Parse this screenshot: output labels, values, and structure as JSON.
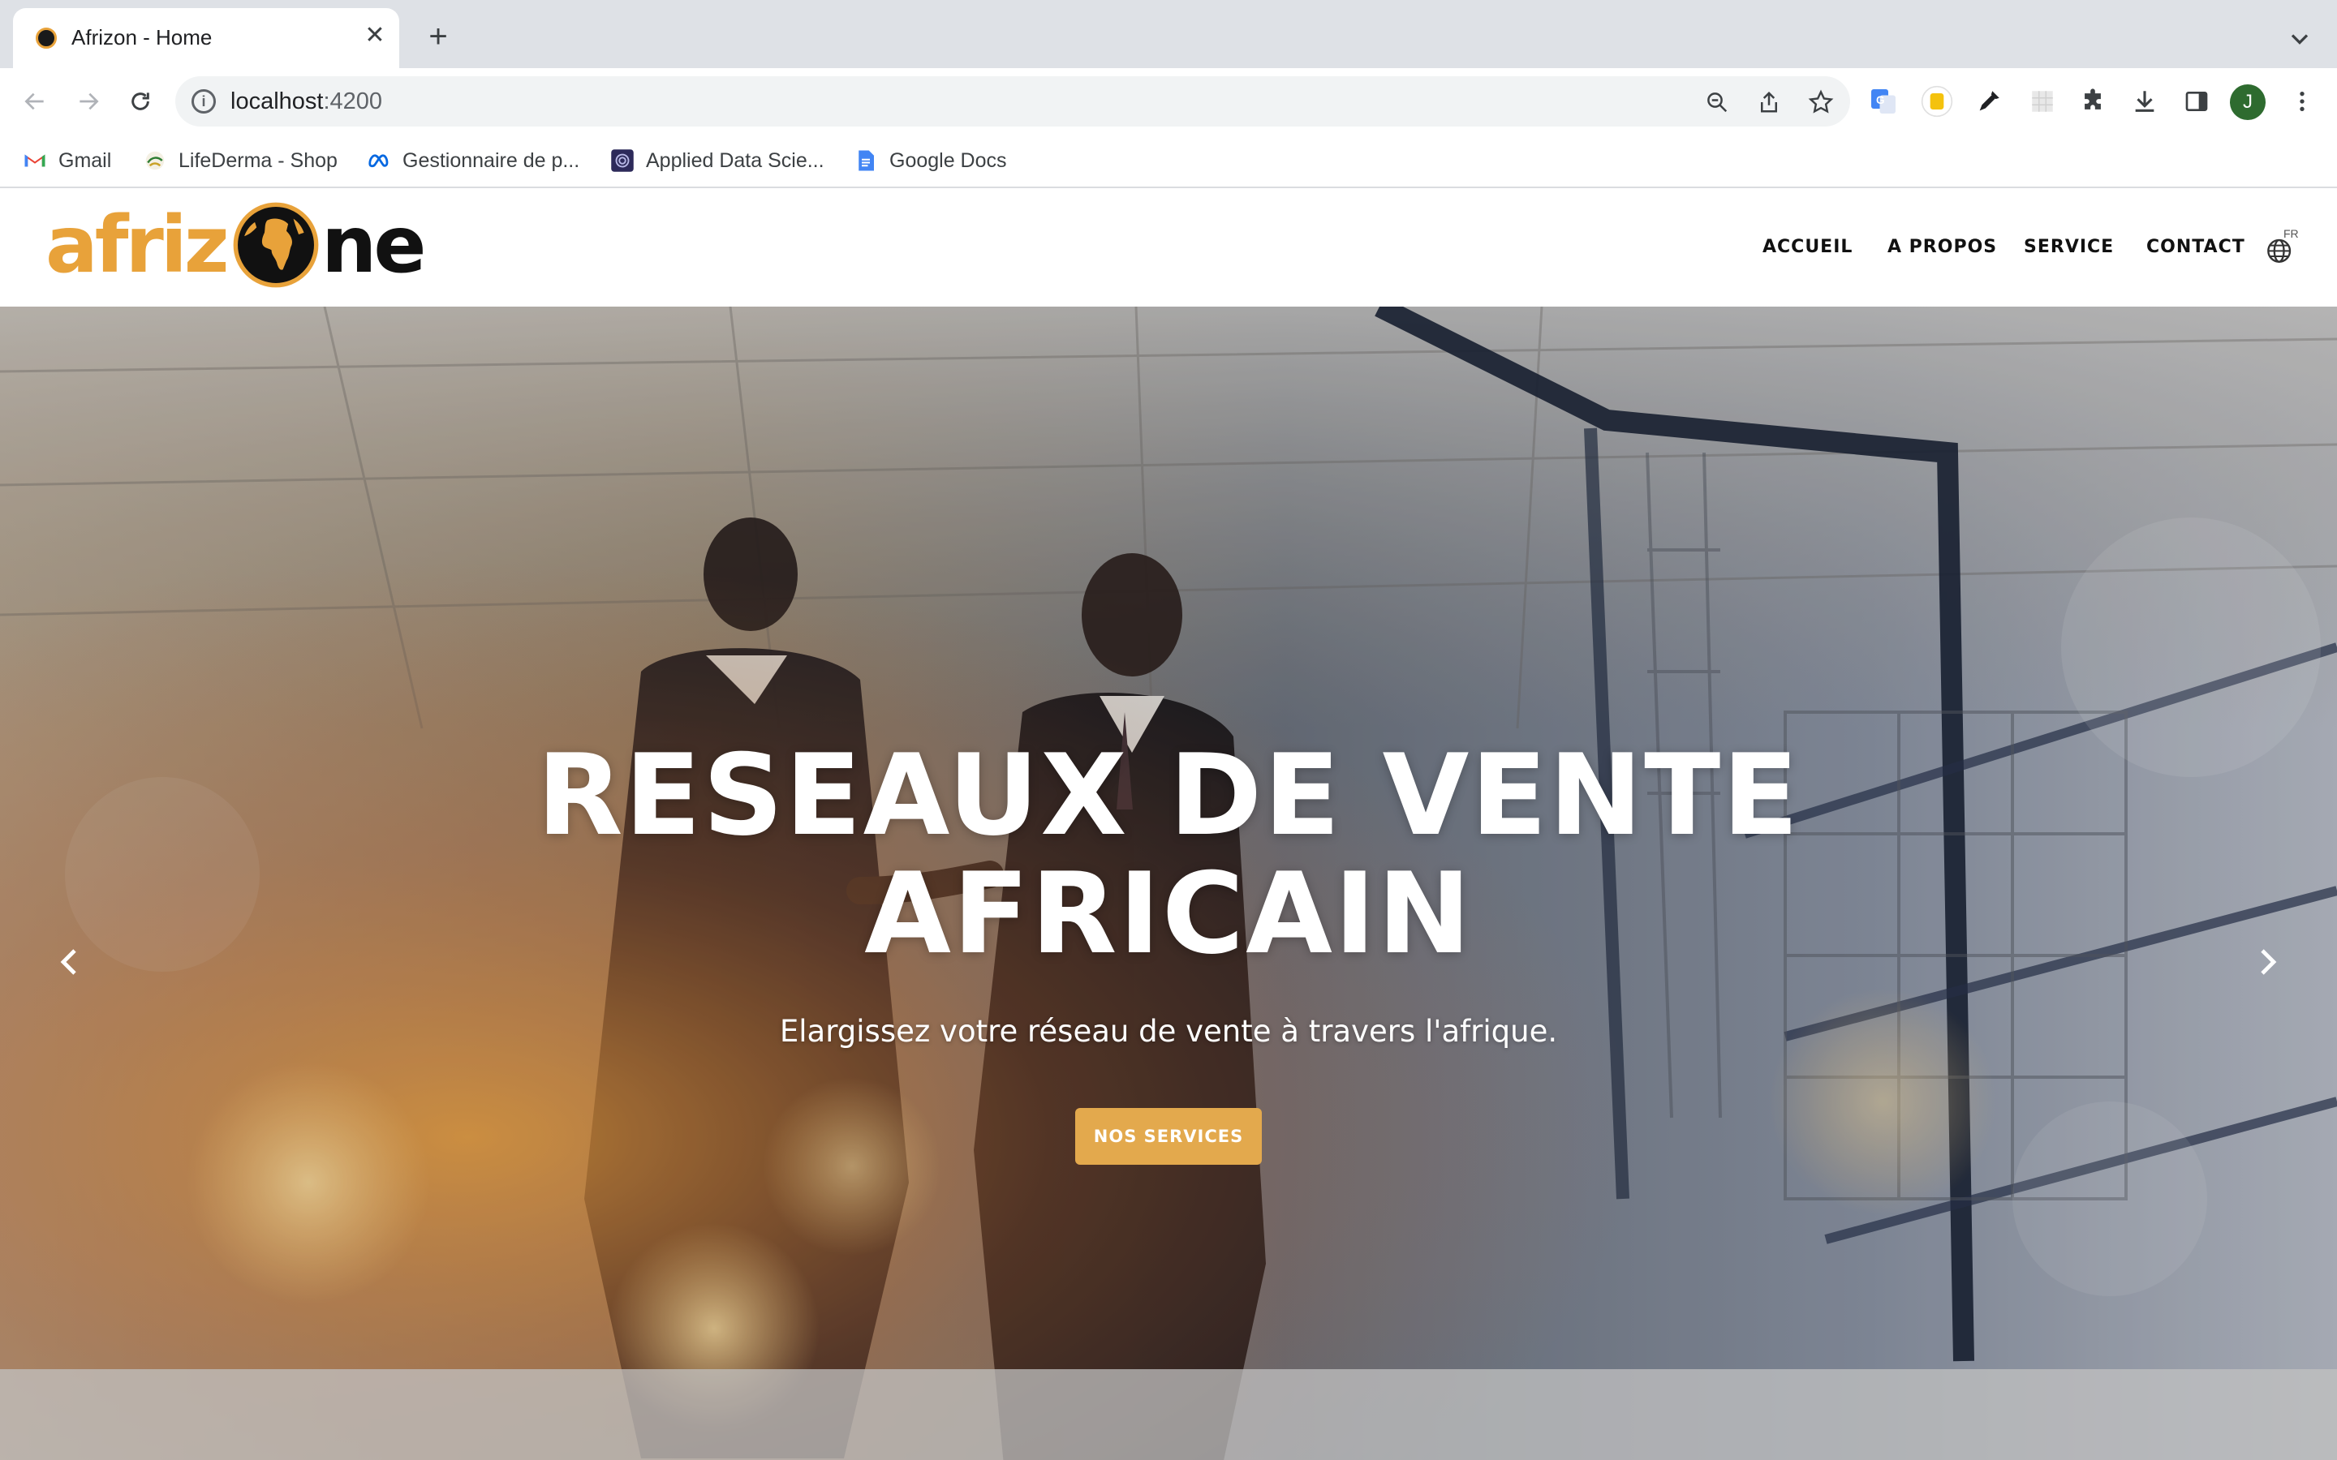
{
  "browser": {
    "tab_title": "Afrizon - Home",
    "close_glyph": "✕",
    "newtab_glyph": "+",
    "url_host": "localhost",
    "url_port": ":4200",
    "profile_initial": "J",
    "bookmarks": [
      {
        "label": "Gmail",
        "icon": "gmail-icon"
      },
      {
        "label": "LifeDerma - Shop",
        "icon": "lifederma-icon"
      },
      {
        "label": "Gestionnaire de p...",
        "icon": "meta-icon"
      },
      {
        "label": "Applied Data Scie...",
        "icon": "applied-data-icon"
      },
      {
        "label": "Google Docs",
        "icon": "google-docs-icon"
      }
    ]
  },
  "site": {
    "logo": {
      "left": "afriz",
      "right": "ne"
    },
    "nav": [
      {
        "label": "ACCUEIL"
      },
      {
        "label": "A PROPOS"
      },
      {
        "label": "SERVICE"
      },
      {
        "label": "CONTACT"
      }
    ],
    "lang_code": "FR",
    "hero": {
      "title_line1": "RESEAUX DE VENTE",
      "title_line2": "AFRICAIN",
      "subtitle": "Elargissez votre réseau de vente à travers l'afrique.",
      "button": "NOS SERVICES"
    }
  },
  "colors": {
    "brand_orange": "#e8a23a",
    "button": "#e3a94d",
    "nav_text": "#111111"
  }
}
